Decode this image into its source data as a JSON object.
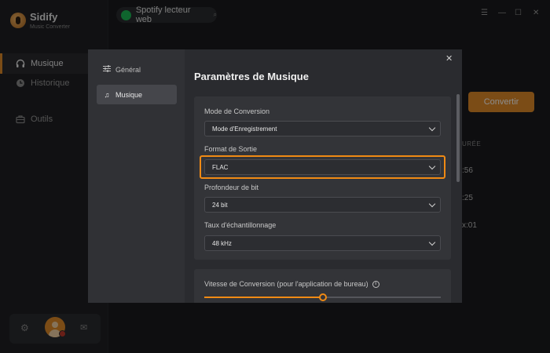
{
  "app": {
    "name": "Sidify",
    "subtitle": "Music Converter"
  },
  "sidebar": {
    "items": [
      {
        "label": "Musique",
        "icon": "headphones-icon",
        "active": true
      },
      {
        "label": "Historique",
        "icon": "clock-icon",
        "active": false
      },
      {
        "label": "Outils",
        "icon": "toolbox-icon",
        "active": false
      }
    ]
  },
  "browser_tab": {
    "label": "Spotify lecteur web",
    "pin_glyph": "⌕"
  },
  "background": {
    "convert_label": "Convertir",
    "column_header": "URÉE",
    "durations": [
      ":56",
      ":25",
      "x:01"
    ]
  },
  "dialog": {
    "title": "Paramètres de Musique",
    "nav": [
      {
        "label": "Général",
        "icon": "sliders-icon",
        "selected": false
      },
      {
        "label": "Musique",
        "icon": "music-note-icon",
        "selected": true
      }
    ],
    "fields": [
      {
        "label": "Mode de Conversion",
        "value": "Mode d'Enregistrement"
      },
      {
        "label": "Format de Sortie",
        "value": "FLAC",
        "highlighted": true
      },
      {
        "label": "Profondeur de bit",
        "value": "24 bit"
      },
      {
        "label": "Taux d'échantillonnage",
        "value": "48 kHz"
      }
    ],
    "speed": {
      "label": "Vitesse de Conversion (pour l'application de bureau)",
      "value_fraction": 0.5
    }
  },
  "colors": {
    "accent": "#f08a14",
    "spotify": "#1db954",
    "dialog_bg": "#2a2b2f"
  }
}
